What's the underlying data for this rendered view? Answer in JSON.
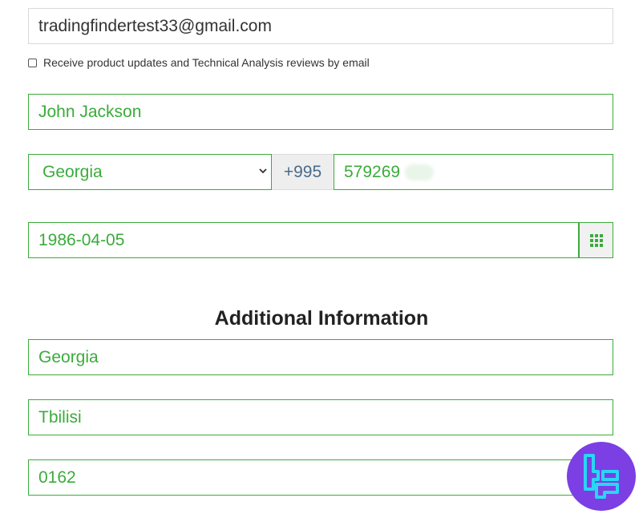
{
  "form": {
    "email": "tradingfindertest33@gmail.com",
    "newsletter_label": "Receive product updates and Technical Analysis reviews by email",
    "newsletter_checked": false,
    "full_name": "John Jackson",
    "country": "Georgia",
    "phone_prefix": "+995",
    "phone": "579269",
    "birth_date": "1986-04-05",
    "calendar_icon": "calendar-grid-icon"
  },
  "additional": {
    "heading": "Additional Information",
    "country": "Georgia",
    "city": "Tbilisi",
    "postal_code": "0162"
  },
  "logo": {
    "name": "tf-logo",
    "bg_color": "#7b3fe4",
    "accent_color": "#2ad5f5"
  },
  "colors": {
    "accent": "#3bab3b",
    "border_muted": "#d9d9d9",
    "prefix_text": "#4a6a8a"
  }
}
